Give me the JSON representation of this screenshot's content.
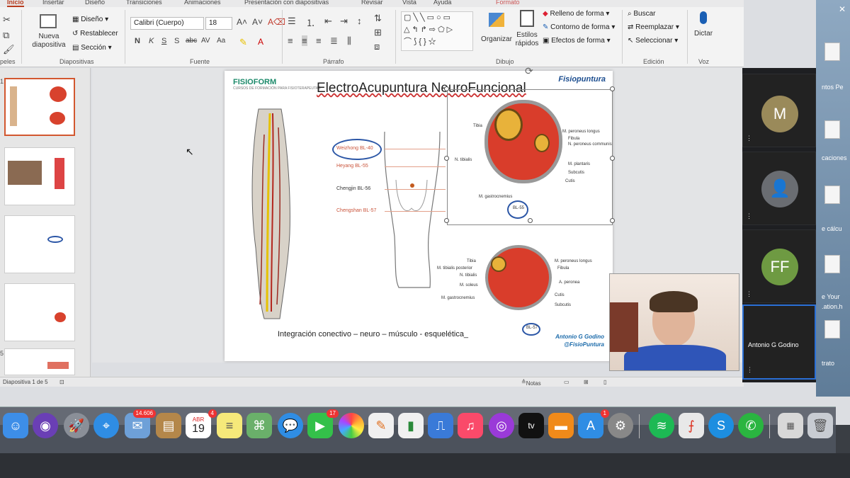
{
  "ribbon": {
    "tabs": [
      "Inicio",
      "Insertar",
      "Diseño",
      "Transiciones",
      "Animaciones",
      "Presentación con diapositivas",
      "Revisar",
      "Vista",
      "Ayuda",
      "Formato"
    ],
    "groups": {
      "clipboard_label": "peles",
      "slides_label": "Diapositivas",
      "new_slide": "Nueva diapositiva",
      "layout": "Diseño",
      "reset": "Restablecer",
      "section": "Sección",
      "font_label": "Fuente",
      "font_name": "Calibri (Cuerpo)",
      "font_size": "18",
      "paragraph_label": "Párrafo",
      "drawing_label": "Dibujo",
      "arrange": "Organizar",
      "quick_styles": "Estilos rápidos",
      "shape_fill": "Relleno de forma",
      "shape_outline": "Contorno de forma",
      "shape_effects": "Efectos de forma",
      "edit_label": "Edición",
      "find": "Buscar",
      "replace": "Reemplazar",
      "select": "Seleccionar",
      "voice_label": "Voz",
      "dictate": "Dictar"
    }
  },
  "slide": {
    "title": "ElectroAcupuntura NeuroFuncional",
    "logo_left": "FISIOFORM",
    "logo_left_sub": "CURSOS DE FORMACIÓN PARA FISIOTERAPEUTAS",
    "logo_right": "Fisiopuntura",
    "caption": "Integración conectivo – neuro – músculo - esquelética_",
    "author_name": "Antonio G Godino",
    "author_handle": "@FisioPuntura",
    "points": [
      "Weizhong BL-40",
      "Heyang BL-55",
      "Chengjin BL-56",
      "Chengshan BL-57"
    ],
    "anatomy_top": [
      "Tibia",
      "M. peroneus longus",
      "Fibula",
      "N. peroneus communis",
      "N. tibialis",
      "M. plantaris",
      "Subcutis",
      "Cutis",
      "M. gastrocnemius",
      "BL-55"
    ],
    "anatomy_bottom": [
      "Tibia",
      "M. peroneus longus",
      "M. tibialis posterior",
      "Fibula",
      "N. tibialis",
      "A. peronea",
      "M. soleus",
      "Cutis",
      "M. gastrocnemius",
      "Subcutis",
      "BL-57"
    ]
  },
  "status": {
    "slide_counter": "Diapositiva 1 de 5",
    "notes": "Notas"
  },
  "video": {
    "tiles": [
      {
        "initials": "M"
      },
      {
        "initials": ""
      },
      {
        "initials": "FF"
      },
      {
        "name": "Antonio G Godino"
      }
    ]
  },
  "desktop": {
    "labels": [
      "ntos Pe",
      "caciones",
      "e cálcu",
      "e Your",
      ".ation.h",
      "trato"
    ]
  },
  "dock": {
    "mail_badge": "14.606",
    "calendar_month": "ABR",
    "calendar_day": "19",
    "calendar_badge": "4",
    "facetime_badge": "17",
    "appstore_badge": "1",
    "appletv_label": "tv"
  }
}
